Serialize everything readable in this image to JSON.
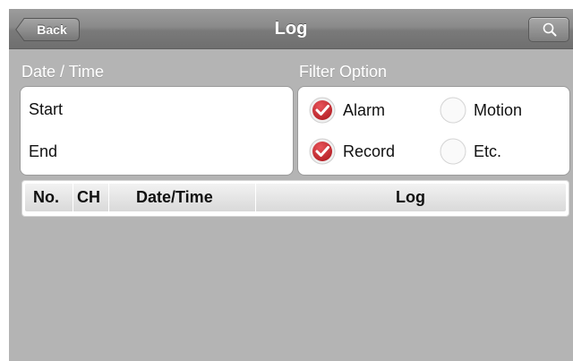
{
  "navbar": {
    "back_label": "Back",
    "title": "Log",
    "search_icon": "search-icon"
  },
  "date_time": {
    "header": "Date / Time",
    "start_label": "Start",
    "end_label": "End"
  },
  "filter": {
    "header": "Filter Option",
    "options": [
      {
        "label": "Alarm",
        "checked": true
      },
      {
        "label": "Motion",
        "checked": false
      },
      {
        "label": "Record",
        "checked": true
      },
      {
        "label": "Etc.",
        "checked": false
      }
    ]
  },
  "table": {
    "columns": [
      "No.",
      "CH",
      "Date/Time",
      "Log"
    ]
  },
  "colors": {
    "check_red": "#c8282c",
    "background_gray": "#b4b4b4"
  }
}
